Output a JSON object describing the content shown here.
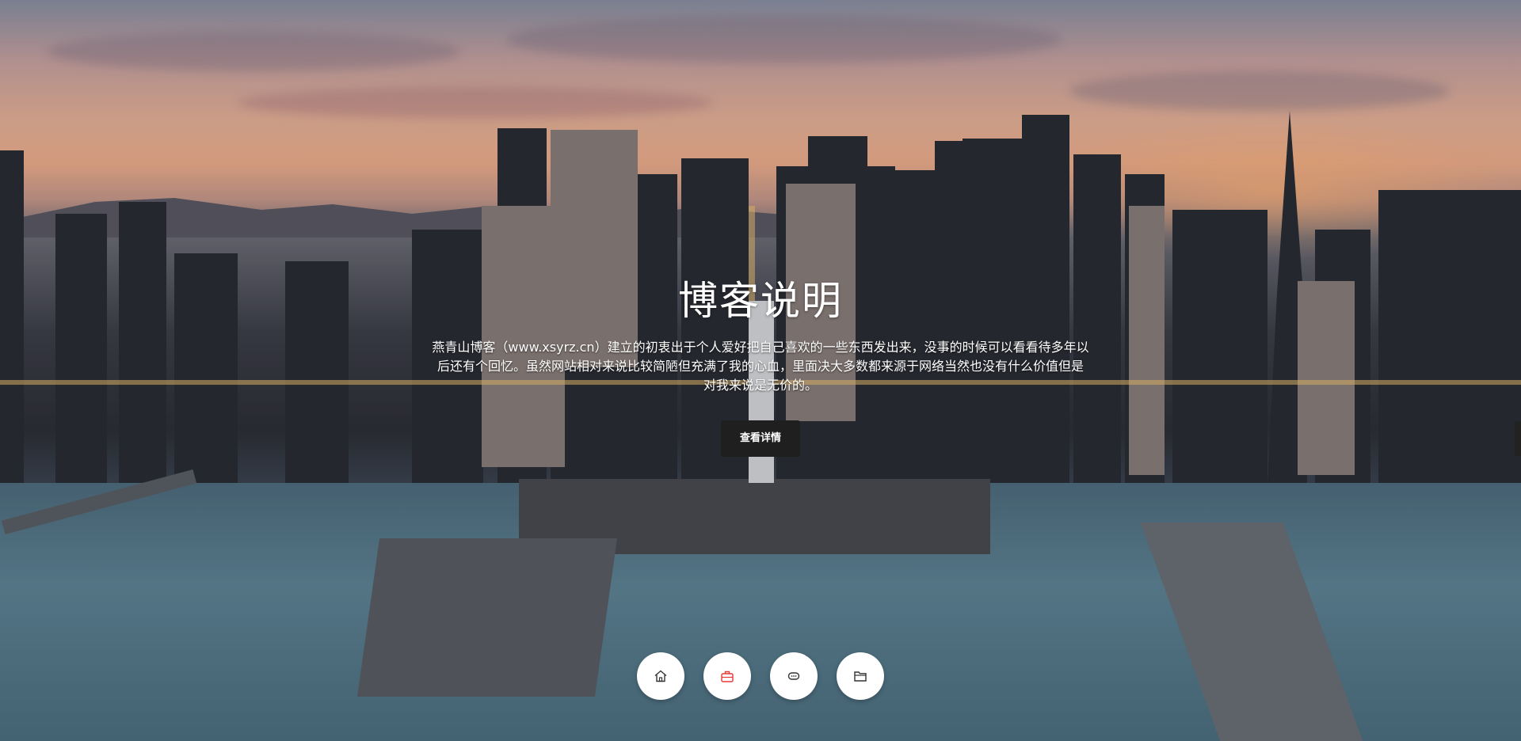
{
  "hero": {
    "title": "博客说明",
    "description": "燕青山博客（www.xsyrz.cn）建立的初衷出于个人爱好把自己喜欢的一些东西发出来，没事的时候可以看看待多年以后还有个回忆。虽然网站相对来说比较简陋但充满了我的心血，里面决大多数都来源于网络当然也没有什么价值但是对我来说是无价的。",
    "detail_button": "查看详情"
  },
  "icons": [
    {
      "name": "home-icon",
      "color": "#333333"
    },
    {
      "name": "briefcase-icon",
      "color": "#e53935"
    },
    {
      "name": "chat-icon",
      "color": "#333333"
    },
    {
      "name": "folder-icon",
      "color": "#333333"
    }
  ],
  "colors": {
    "button_bg": "#1f1f1f",
    "text": "#ffffff",
    "accent_red": "#e53935"
  }
}
